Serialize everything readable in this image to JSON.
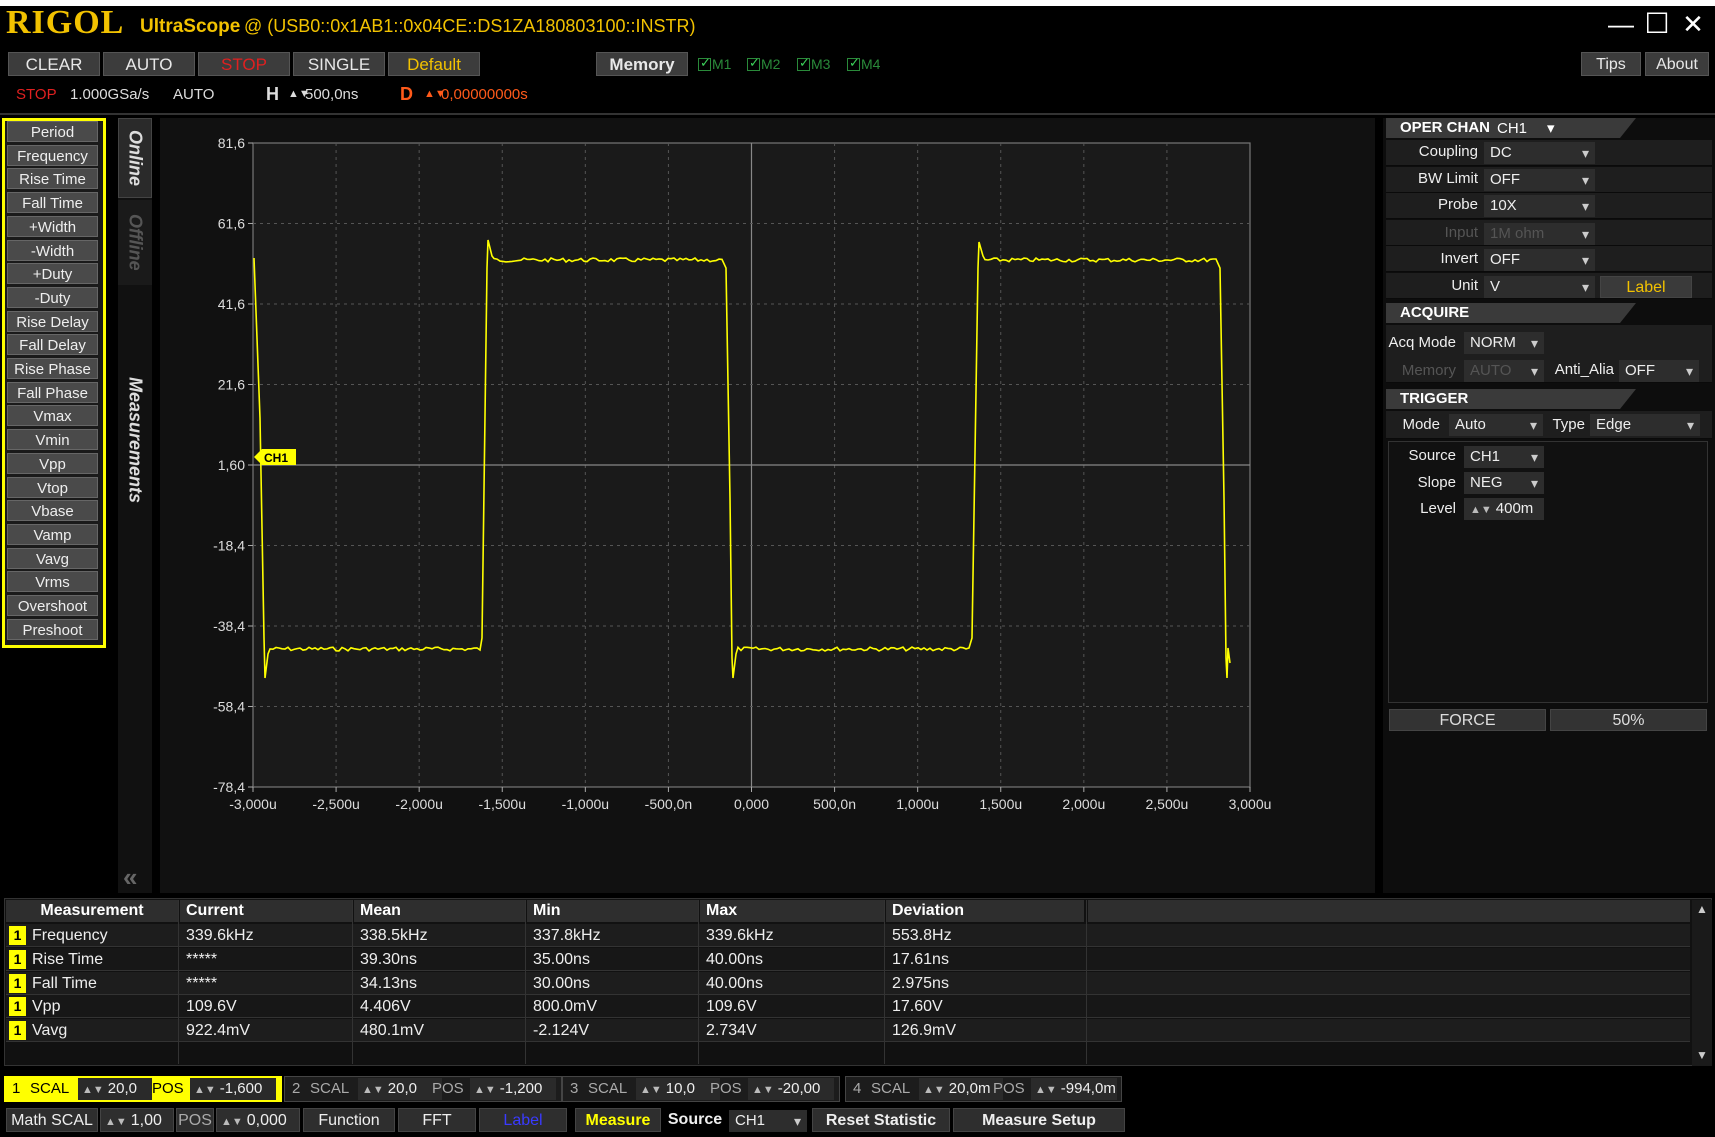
{
  "titlebar": {
    "brand": "RIGOL",
    "app": "UltraScope",
    "connection": "@ (USB0::0x1AB1::0x04CE::DS1ZA180803100::INSTR)",
    "minimize": "—",
    "maximize": "☐",
    "close": "✕"
  },
  "toolbar": {
    "clear": "CLEAR",
    "auto": "AUTO",
    "stop": "STOP",
    "single": "SINGLE",
    "default": "Default",
    "memory": "Memory",
    "m1": "M1",
    "m2": "M2",
    "m3": "M3",
    "m4": "M4",
    "tips": "Tips",
    "about": "About"
  },
  "status": {
    "run_state": "STOP",
    "sample_rate": "1.000GSa/s",
    "trig_mode": "AUTO",
    "h_label": "H",
    "h_value": "500,0ns",
    "d_label": "D",
    "d_value": "0,00000000s",
    "spin": "▲▼"
  },
  "meas_list": [
    "Period",
    "Frequency",
    "Rise Time",
    "Fall Time",
    "+Width",
    "-Width",
    "+Duty",
    "-Duty",
    "Rise Delay",
    "Fall Delay",
    "Rise Phase",
    "Fall Phase",
    "Vmax",
    "Vmin",
    "Vpp",
    "Vtop",
    "Vbase",
    "Vamp",
    "Vavg",
    "Vrms",
    "Overshoot",
    "Preshoot"
  ],
  "side_tabs": {
    "online": "Online",
    "offline": "Offline",
    "measurements": "Measurements",
    "collapse": "«"
  },
  "scope": {
    "y_ticks": [
      "81,6",
      "61,6",
      "41,6",
      "21,6",
      "1,60",
      "-18,4",
      "-38,4",
      "-58,4",
      "-78,4"
    ],
    "x_ticks": [
      "-3,000u",
      "-2,500u",
      "-2,000u",
      "-1,500u",
      "-1,000u",
      "-500,0n",
      "0,000",
      "500,0n",
      "1,000u",
      "1,500u",
      "2,000u",
      "2,500u",
      "3,000u"
    ],
    "ch_marker": "CH1",
    "trace_color": "#ffff00"
  },
  "right_panel": {
    "oper_chan_label": "OPER CHAN",
    "oper_chan_value": "CH1",
    "coupling_label": "Coupling",
    "coupling_value": "DC",
    "bw_label": "BW Limit",
    "bw_value": "OFF",
    "probe_label": "Probe",
    "probe_value": "10X",
    "input_label": "Input",
    "input_value": "1M ohm",
    "invert_label": "Invert",
    "invert_value": "OFF",
    "unit_label": "Unit",
    "unit_value": "V",
    "label_btn": "Label",
    "acquire_hdr": "ACQUIRE",
    "acq_mode_label": "Acq Mode",
    "acq_mode_value": "NORM",
    "memory_label": "Memory",
    "memory_value": "AUTO",
    "anti_alia_label": "Anti_Alia",
    "anti_alia_value": "OFF",
    "trigger_hdr": "TRIGGER",
    "mode_label": "Mode",
    "mode_value": "Auto",
    "type_label": "Type",
    "type_value": "Edge",
    "source_label": "Source",
    "source_value": "CH1",
    "slope_label": "Slope",
    "slope_value": "NEG",
    "level_label": "Level",
    "level_value": "400m",
    "force": "FORCE",
    "fifty": "50%"
  },
  "meas_table": {
    "headers": [
      "Measurement",
      "Current",
      "Mean",
      "Min",
      "Max",
      "Deviation"
    ],
    "rows": [
      {
        "ch": "1",
        "name": "Frequency",
        "current": "339.6kHz",
        "mean": "338.5kHz",
        "min": "337.8kHz",
        "max": "339.6kHz",
        "dev": "553.8Hz"
      },
      {
        "ch": "1",
        "name": "Rise Time",
        "current": "*****",
        "mean": "39.30ns",
        "min": "35.00ns",
        "max": "40.00ns",
        "dev": "17.61ns"
      },
      {
        "ch": "1",
        "name": "Fall Time",
        "current": "*****",
        "mean": "34.13ns",
        "min": "30.00ns",
        "max": "40.00ns",
        "dev": "2.975ns"
      },
      {
        "ch": "1",
        "name": "Vpp",
        "current": "109.6V",
        "mean": "4.406V",
        "min": "800.0mV",
        "max": "109.6V",
        "dev": "17.60V"
      },
      {
        "ch": "1",
        "name": "Vavg",
        "current": "922.4mV",
        "mean": "480.1mV",
        "min": "-2.124V",
        "max": "2.734V",
        "dev": "126.9mV"
      }
    ],
    "scroll_up": "▲",
    "scroll_down": "▼"
  },
  "channels": [
    {
      "num": "1",
      "scal_label": "SCAL",
      "scal": "20,0",
      "pos_label": "POS",
      "pos": "-1,600"
    },
    {
      "num": "2",
      "scal_label": "SCAL",
      "scal": "20,0",
      "pos_label": "POS",
      "pos": "-1,200"
    },
    {
      "num": "3",
      "scal_label": "SCAL",
      "scal": "10,0",
      "pos_label": "POS",
      "pos": "-20,00"
    },
    {
      "num": "4",
      "scal_label": "SCAL",
      "scal": "20,0m",
      "pos_label": "POS",
      "pos": "-994,0m"
    }
  ],
  "bottom": {
    "math_scal_label": "Math SCAL",
    "math_scal": "1,00",
    "pos_label": "POS",
    "math_pos": "0,000",
    "function": "Function",
    "fft": "FFT",
    "label": "Label",
    "measure": "Measure",
    "source_label": "Source",
    "source_value": "CH1",
    "reset_stat": "Reset  Statistic",
    "meas_setup": "Measure  Setup"
  }
}
